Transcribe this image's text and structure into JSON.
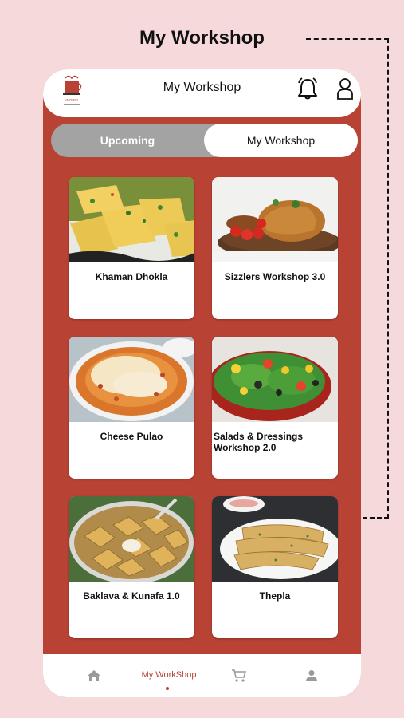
{
  "page": {
    "heading": "My Workshop"
  },
  "app": {
    "title": "My Workshop",
    "logo_text": "aroma",
    "accent_color": "#b84234"
  },
  "header_icons": [
    "bell-icon",
    "user-icon"
  ],
  "segment": {
    "tabs": [
      {
        "label": "Upcoming",
        "active": false
      },
      {
        "label": "My Workshop",
        "active": true
      }
    ]
  },
  "workshops": [
    {
      "name": "Khaman Dhokla"
    },
    {
      "name": "Sizzlers Workshop 3.0"
    },
    {
      "name": "Cheese Pulao"
    },
    {
      "name": "Salads & Dressings Workshop 2.0"
    },
    {
      "name": "Baklava & Kunafa 1.0"
    },
    {
      "name": "Thepla"
    }
  ],
  "bottom_nav": {
    "items": [
      {
        "icon": "home-icon",
        "label": ""
      },
      {
        "icon": "",
        "label": "My WorkShop",
        "active": true
      },
      {
        "icon": "cart-icon",
        "label": ""
      },
      {
        "icon": "profile-icon",
        "label": ""
      }
    ]
  }
}
